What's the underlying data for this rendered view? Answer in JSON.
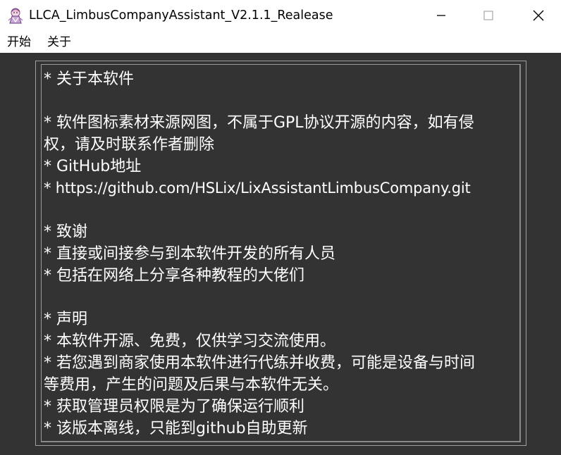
{
  "window": {
    "title": "LLCA_LimbusCompanyAssistant_V2.1.1_Realease",
    "icon": "app-icon"
  },
  "menu": {
    "items": [
      {
        "label": "开始"
      },
      {
        "label": "关于"
      }
    ]
  },
  "about": {
    "lines": [
      "* 关于本软件",
      "",
      "* 软件图标素材来源网图，不属于GPL协议开源的内容，如有侵",
      "权，请及时联系作者删除",
      "* GitHub地址",
      "* https://github.com/HSLix/LixAssistantLimbusCompany.git",
      "",
      "* 致谢",
      "* 直接或间接参与到本软件开发的所有人员",
      "* 包括在网络上分享各种教程的大佬们",
      "",
      "* 声明",
      "* 本软件开源、免费，仅供学习交流使用。",
      "* 若您遇到商家使用本软件进行代练并收费，可能是设备与时间",
      "等费用，产生的问题及后果与本软件无关。",
      "* 获取管理员权限是为了确保运行顺利",
      "* 该版本离线，只能到github自助更新"
    ]
  },
  "colors": {
    "background": "#333333",
    "text": "#ffffff",
    "chrome": "#ffffff"
  }
}
